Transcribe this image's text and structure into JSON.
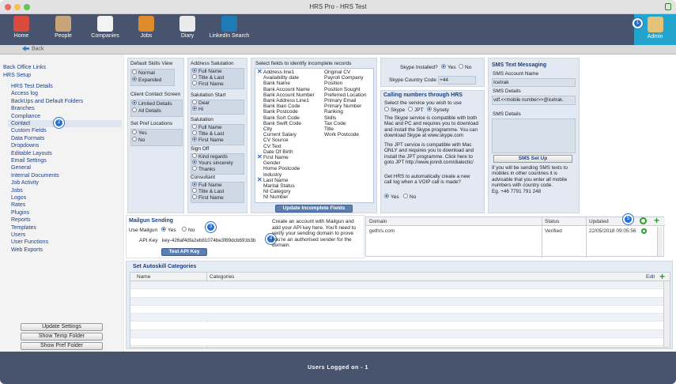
{
  "window_title": "HRS Pro - HRS Test",
  "toolbar": [
    "Home",
    "People",
    "Companies",
    "Jobs",
    "Diary",
    "LinkedIn Search"
  ],
  "toolbar_admin": "Admin",
  "nav_back": "Back",
  "sidebar": {
    "back_office": "Back Office Links",
    "hrs_setup": "HRS Setup",
    "items": [
      "HRS Test Details",
      "Access log",
      "BackUps and Default Folders",
      "Branches",
      "Compliance",
      "Contact",
      "Custom Fields",
      "Data Formats",
      "Dropdowns",
      "Editable Layouts",
      "Email Settings",
      "General",
      "Internal Documents",
      "Job Activity",
      "Jobs",
      "Logos",
      "Rates",
      "Plugins",
      "Reports",
      "Templates",
      "Users",
      "User Functions",
      "Web Exports"
    ],
    "buttons": [
      "Update Settings",
      "Show Temp Folder",
      "Show Pref Folder"
    ]
  },
  "skills": {
    "title": "Default Skills View",
    "opts": [
      "Normal",
      "Expanded"
    ]
  },
  "client": {
    "title": "Client Contact Screen",
    "opts": [
      "Limited Details",
      "All Details"
    ]
  },
  "pref": {
    "title": "Set Pref Locations",
    "opts": [
      "Yes",
      "No"
    ]
  },
  "addr": {
    "title": "Address Salutation",
    "opts": [
      "Full Name",
      "Title & Last",
      "First Name"
    ]
  },
  "salstart": {
    "title": "Salutation Start",
    "opts": [
      "Dear",
      "Hi"
    ]
  },
  "sal": {
    "title": "Salutation",
    "opts": [
      "Full Name",
      "Title & Last",
      "First Name"
    ]
  },
  "signoff": {
    "title": "Sign Off",
    "opts": [
      "Kind regards",
      "Yours sincerely",
      "Thanks"
    ]
  },
  "consultant": {
    "title": "Consultant",
    "opts": [
      "Full Name",
      "Title & Last",
      "First Name"
    ]
  },
  "incomplete": {
    "title": "Select fields to identify incomplete records",
    "col1": [
      "Address line1",
      "Availability date",
      "Bank Name",
      "Bank Account Name",
      "Bank Account Number",
      "Bank Address Line1",
      "Bank Iban Code",
      "Bank Postcode",
      "Bank Sort Code",
      "Bank Swift Code",
      "City",
      "Current Salary",
      "CV Source",
      "CV Text",
      "Date Of Birth",
      "First Name",
      "Gender",
      "Home Postcode",
      "Industry",
      "Last Name",
      "Marital Status",
      "NI Category",
      "NI Number"
    ],
    "col2": [
      "Original CV",
      "Payroll Company",
      "Position",
      "Position Sought",
      "Preferred Location",
      "Primary Email",
      "Primary Number",
      "Ranking",
      "Skills",
      "Tax Code",
      "Title",
      "Work Postcode"
    ],
    "button": "Update Incomplete Fields"
  },
  "skype": {
    "installed_label": "Skype Installed?",
    "yes": "Yes",
    "no": "No",
    "country_label": "Skype Country Code",
    "country_value": "+44"
  },
  "calling": {
    "title": "Calling numbers through HRS",
    "subtitle": "Select the service you wish to use",
    "opts": [
      "Skype",
      "JPT",
      "Synety"
    ],
    "text1": [
      "The Skype service is compatible with both",
      "Mac and PC and requires you to download",
      "and install the Skype programme. You can",
      "download Skype at www.skype.com"
    ],
    "text2": [
      "The JPT service is compatible with Mac",
      "ONLY and requires you to download and",
      "install the JPT programme. Click here to",
      "goto JPT http://www.jonn8.com/dialectic/"
    ],
    "text3": [
      "Get HRS to automatically create a new",
      "call log when a VOIP call is made?"
    ],
    "voip": [
      "Yes",
      "No"
    ]
  },
  "sms": {
    "title": "SMS Text Messaging",
    "account_label": "SMS Account Name",
    "account_value": "Icetrak",
    "details_label": "SMS Details",
    "details_value": "vdf.<<mobile number>>@icetrak.",
    "details2_label": "SMS Details",
    "button": "SMS Set Up",
    "info": [
      "If you will be sending SMS texts to",
      "mobiles in other countries it is",
      "advisable that you enter all mobile",
      "numbers with country code.",
      "Eg. +46 7791 791 248"
    ]
  },
  "mailgun": {
    "title": "Mailgun Sending",
    "use_label": "Use Mailgun",
    "yes": "Yes",
    "no": "No",
    "key_label": "API Key",
    "key_value": "key-426af4dfa2eb81074be3f89dcb691b3b",
    "button": "Test API Key",
    "info": [
      "Create an account with Mailgun and",
      "add your API key here. You'll need to",
      "verify your sending domain to prove",
      "you're an authorised sender for the",
      "domain."
    ]
  },
  "domain_table": {
    "headers": [
      "Domain",
      "Status",
      "Updated"
    ],
    "row": {
      "domain": "gethrs.com",
      "status": "Verified",
      "updated": "22/05/2018 09:05:56"
    }
  },
  "autoskill": {
    "title": "Set Autoskill Categories",
    "headers": [
      "Name",
      "Categories"
    ],
    "edit": "Edit"
  },
  "footer": "Users Logged on - 1",
  "badges": [
    "1",
    "2",
    "3",
    "4",
    "5"
  ]
}
